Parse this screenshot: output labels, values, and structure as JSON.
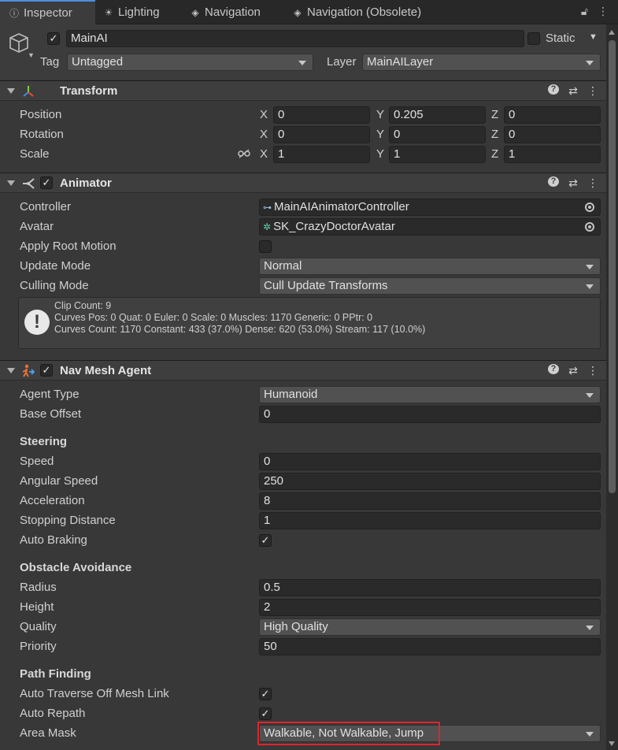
{
  "tabs": [
    {
      "label": "Inspector",
      "icon": "info-icon"
    },
    {
      "label": "Lighting",
      "icon": "bulb-icon"
    },
    {
      "label": "Navigation",
      "icon": "navigation-icon"
    },
    {
      "label": "Navigation (Obsolete)",
      "icon": "navigation-icon"
    }
  ],
  "gameobject": {
    "name": "MainAI",
    "static_label": "Static",
    "tag_label": "Tag",
    "tag_value": "Untagged",
    "layer_label": "Layer",
    "layer_value": "MainAILayer"
  },
  "transform": {
    "title": "Transform",
    "rows": [
      {
        "label": "Position",
        "x": "0",
        "y": "0.205",
        "z": "0"
      },
      {
        "label": "Rotation",
        "x": "0",
        "y": "0",
        "z": "0"
      },
      {
        "label": "Scale",
        "x": "1",
        "y": "1",
        "z": "1"
      }
    ],
    "axis": {
      "x": "X",
      "y": "Y",
      "z": "Z"
    }
  },
  "animator": {
    "title": "Animator",
    "controller_label": "Controller",
    "controller_value": "MainAIAnimatorController",
    "avatar_label": "Avatar",
    "avatar_value": "SK_CrazyDoctorAvatar",
    "apply_root_motion_label": "Apply Root Motion",
    "update_mode_label": "Update Mode",
    "update_mode_value": "Normal",
    "culling_mode_label": "Culling Mode",
    "culling_mode_value": "Cull Update Transforms",
    "info": {
      "line1": "Clip Count: 9",
      "line2": "Curves Pos: 0 Quat: 0 Euler: 0 Scale: 0 Muscles: 1170 Generic: 0 PPtr: 0",
      "line3": "Curves Count: 1170 Constant: 433 (37.0%) Dense: 620 (53.0%) Stream: 117 (10.0%)"
    }
  },
  "navmesh": {
    "title": "Nav Mesh Agent",
    "agent_type_label": "Agent Type",
    "agent_type_value": "Humanoid",
    "base_offset_label": "Base Offset",
    "base_offset_value": "0",
    "steering_title": "Steering",
    "speed_label": "Speed",
    "speed_value": "0",
    "angular_speed_label": "Angular Speed",
    "angular_speed_value": "250",
    "acceleration_label": "Acceleration",
    "acceleration_value": "8",
    "stopping_distance_label": "Stopping Distance",
    "stopping_distance_value": "1",
    "auto_braking_label": "Auto Braking",
    "obstacle_title": "Obstacle Avoidance",
    "radius_label": "Radius",
    "radius_value": "0.5",
    "height_label": "Height",
    "height_value": "2",
    "quality_label": "Quality",
    "quality_value": "High Quality",
    "priority_label": "Priority",
    "priority_value": "50",
    "pathfinding_title": "Path Finding",
    "auto_traverse_label": "Auto Traverse Off Mesh Link",
    "auto_repath_label": "Auto Repath",
    "area_mask_label": "Area Mask",
    "area_mask_value": "Walkable, Not Walkable, Jump"
  },
  "colors": {
    "accent_tab": "#4d8ee0",
    "highlight": "#e0242b",
    "panel": "#383838"
  }
}
